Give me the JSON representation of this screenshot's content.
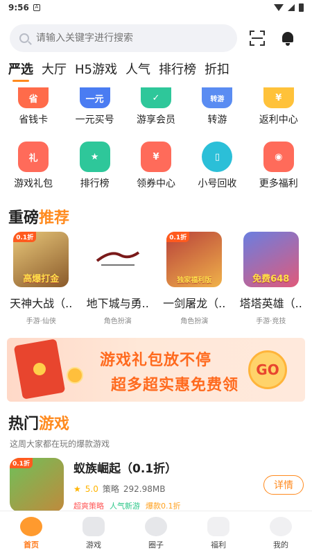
{
  "status_bar": {
    "time": "9:56",
    "notif_letter": "A"
  },
  "search": {
    "placeholder": "请输入关键字进行搜索"
  },
  "tabs": [
    {
      "label": "严选",
      "active": true
    },
    {
      "label": "大厅"
    },
    {
      "label": "H5游戏"
    },
    {
      "label": "人气"
    },
    {
      "label": "排行榜"
    },
    {
      "label": "折扣"
    }
  ],
  "grid_row1": [
    {
      "label": "省钱卡",
      "icon": "wallet-icon",
      "text": "省",
      "color": "#ff6b4a"
    },
    {
      "label": "一元买号",
      "icon": "one-yuan-icon",
      "text": "一元",
      "color": "#4a7cf2"
    },
    {
      "label": "游享会员",
      "icon": "vip-icon",
      "text": "✓",
      "color": "#2ec79a"
    },
    {
      "label": "转游",
      "icon": "transfer-icon",
      "text": "转游",
      "color": "#5a8cf2"
    },
    {
      "label": "返利中心",
      "icon": "rebate-icon",
      "text": "¥",
      "color": "#ffc23a"
    }
  ],
  "grid_row2": [
    {
      "label": "游戏礼包",
      "icon": "gift-icon",
      "text": "礼",
      "color": "#ff6b5a"
    },
    {
      "label": "排行榜",
      "icon": "trophy-icon",
      "text": "★",
      "color": "#2ec79a"
    },
    {
      "label": "领券中心",
      "icon": "coupon-icon",
      "text": "¥",
      "color": "#ff6b5a"
    },
    {
      "label": "小号回收",
      "icon": "phone-icon",
      "text": "▯",
      "color": "#2bbfd8"
    },
    {
      "label": "更多福利",
      "icon": "welfare-icon",
      "text": "◉",
      "color": "#ff6b5a"
    }
  ],
  "featured": {
    "title_a": "重磅",
    "title_b": "推荐",
    "games": [
      {
        "name": "天神大战（..",
        "sub": "手游·仙侠",
        "tag": "0.1折",
        "caption": "高爆打金",
        "c1": "#e8c77a",
        "c2": "#8a5a2a"
      },
      {
        "name": "地下城与勇..",
        "sub": "角色扮演",
        "tag": "",
        "caption": "",
        "c1": "#ffffff",
        "c2": "#f2f2f2"
      },
      {
        "name": "一剑屠龙（..",
        "sub": "角色扮演",
        "tag": "0.1折",
        "caption": "独家福利版",
        "c1": "#b8413a",
        "c2": "#f0b24a"
      },
      {
        "name": "塔塔英雄（..",
        "sub": "手游·竞技",
        "tag": "",
        "caption": "免费648",
        "c1": "#6a7ee0",
        "c2": "#e05a7a"
      }
    ]
  },
  "banner": {
    "line1": "游戏礼包放不停",
    "line2": "超多超实惠免费领",
    "go": "GO"
  },
  "hot": {
    "title_a": "热门",
    "title_b": "游戏",
    "subtitle": "这周大家都在玩的爆款游戏",
    "item": {
      "name": "蚁族崛起（0.1折）",
      "tag": "0.1折",
      "rating": "5.0",
      "genre": "策略",
      "size": "292.98MB",
      "labels": [
        {
          "text": "超爽策略",
          "color": "#ff5a5a"
        },
        {
          "text": "人气新游",
          "color": "#2ec78a"
        },
        {
          "text": "爆款0.1折",
          "color": "#ffa01e"
        }
      ],
      "button": "详情"
    }
  },
  "bottom_nav": [
    {
      "label": "首页",
      "active": true
    },
    {
      "label": "游戏"
    },
    {
      "label": "圈子"
    },
    {
      "label": "福利"
    },
    {
      "label": "我的"
    }
  ]
}
